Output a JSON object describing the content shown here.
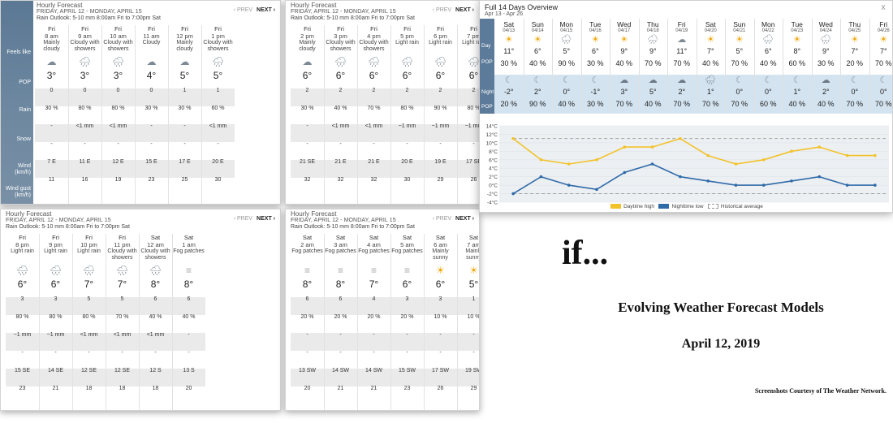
{
  "panels": [
    {
      "title": "Hourly Forecast",
      "range": "FRIDAY, APRIL 12 - MONDAY, APRIL 15",
      "outlook": "Rain Outlook: 5-10 mm 8:00am Fri to 7:00pm Sat",
      "prev": "‹ PREV",
      "next": "NEXT ›",
      "hours": [
        {
          "day": "Fri",
          "time": "8 am",
          "cond": "Mainly cloudy",
          "icon": "☁",
          "temp": "3°",
          "feels": "0",
          "pop": "30 %",
          "rain": "-",
          "snow": "-",
          "wind": "7 E",
          "gust": "11"
        },
        {
          "day": "Fri",
          "time": "9 am",
          "cond": "Cloudy with showers",
          "icon": "🌧",
          "temp": "3°",
          "feels": "0",
          "pop": "80 %",
          "rain": "<1 mm",
          "snow": "-",
          "wind": "11 E",
          "gust": "16"
        },
        {
          "day": "Fri",
          "time": "10 am",
          "cond": "Cloudy with showers",
          "icon": "🌧",
          "temp": "3°",
          "feels": "0",
          "pop": "80 %",
          "rain": "<1 mm",
          "snow": "-",
          "wind": "12 E",
          "gust": "19"
        },
        {
          "day": "Fri",
          "time": "11 am",
          "cond": "Cloudy",
          "icon": "☁",
          "temp": "4°",
          "feels": "0",
          "pop": "30 %",
          "rain": "-",
          "snow": "-",
          "wind": "15 E",
          "gust": "23"
        },
        {
          "day": "Fri",
          "time": "12 pm",
          "cond": "Mainly cloudy",
          "icon": "☁",
          "temp": "5°",
          "feels": "1",
          "pop": "30 %",
          "rain": "-",
          "snow": "-",
          "wind": "17 E",
          "gust": "25"
        },
        {
          "day": "Fri",
          "time": "1 pm",
          "cond": "Cloudy with showers",
          "icon": "🌧",
          "temp": "5°",
          "feels": "1",
          "pop": "60 %",
          "rain": "<1 mm",
          "snow": "-",
          "wind": "20 E",
          "gust": "30"
        }
      ]
    },
    {
      "title": "Hourly Forecast",
      "range": "FRIDAY, APRIL 12 - MONDAY, APRIL 15",
      "outlook": "Rain Outlook: 5-10 mm 8:00am Fri to 7:00pm Sat",
      "prev": "‹ PREV",
      "next": "NEXT ›",
      "hours": [
        {
          "day": "Fri",
          "time": "2 pm",
          "cond": "Mainly cloudy",
          "icon": "☁",
          "temp": "6°",
          "feels": "2",
          "pop": "30 %",
          "rain": "-",
          "snow": "-",
          "wind": "21 SE",
          "gust": "32"
        },
        {
          "day": "Fri",
          "time": "3 pm",
          "cond": "Cloudy with showers",
          "icon": "🌧",
          "temp": "6°",
          "feels": "2",
          "pop": "40 %",
          "rain": "<1 mm",
          "snow": "-",
          "wind": "21 E",
          "gust": "32"
        },
        {
          "day": "Fri",
          "time": "4 pm",
          "cond": "Cloudy with showers",
          "icon": "🌧",
          "temp": "6°",
          "feels": "2",
          "pop": "70 %",
          "rain": "<1 mm",
          "snow": "-",
          "wind": "21 E",
          "gust": "32"
        },
        {
          "day": "Fri",
          "time": "5 pm",
          "cond": "Light rain",
          "icon": "🌧",
          "temp": "6°",
          "feels": "2",
          "pop": "80 %",
          "rain": "~1 mm",
          "snow": "-",
          "wind": "20 E",
          "gust": "30"
        },
        {
          "day": "Fri",
          "time": "6 pm",
          "cond": "Light rain",
          "icon": "🌧",
          "temp": "6°",
          "feels": "2",
          "pop": "90 %",
          "rain": "~1 mm",
          "snow": "-",
          "wind": "19 E",
          "gust": "29"
        },
        {
          "day": "Fri",
          "time": "7 pm",
          "cond": "Light rain",
          "icon": "🌧",
          "temp": "6°",
          "feels": "2",
          "pop": "80 %",
          "rain": "~1 mm",
          "snow": "-",
          "wind": "17 SE",
          "gust": "26"
        }
      ]
    },
    {
      "title": "Hourly Forecast",
      "range": "FRIDAY, APRIL 12 - MONDAY, APRIL 15",
      "outlook": "Rain Outlook: 5-10 mm 8:00am Fri to 7:00pm Sat",
      "prev": "‹ PREV",
      "next": "NEXT ›",
      "hours": [
        {
          "day": "Fri",
          "time": "8 pm",
          "cond": "Light rain",
          "icon": "🌧",
          "temp": "6°",
          "feels": "3",
          "pop": "80 %",
          "rain": "~1 mm",
          "snow": "-",
          "wind": "15 SE",
          "gust": "23"
        },
        {
          "day": "Fri",
          "time": "9 pm",
          "cond": "Light rain",
          "icon": "🌧",
          "temp": "6°",
          "feels": "3",
          "pop": "80 %",
          "rain": "~1 mm",
          "snow": "-",
          "wind": "14 SE",
          "gust": "21"
        },
        {
          "day": "Fri",
          "time": "10 pm",
          "cond": "Light rain",
          "icon": "🌧",
          "temp": "7°",
          "feels": "5",
          "pop": "80 %",
          "rain": "<1 mm",
          "snow": "-",
          "wind": "12 SE",
          "gust": "18"
        },
        {
          "day": "Fri",
          "time": "11 pm",
          "cond": "Cloudy with showers",
          "icon": "🌧",
          "temp": "7°",
          "feels": "5",
          "pop": "70 %",
          "rain": "<1 mm",
          "snow": "-",
          "wind": "12 SE",
          "gust": "18"
        },
        {
          "day": "Sat",
          "time": "12 am",
          "cond": "Cloudy with showers",
          "icon": "🌧",
          "temp": "8°",
          "feels": "6",
          "pop": "40 %",
          "rain": "<1 mm",
          "snow": "-",
          "wind": "12 S",
          "gust": "18"
        },
        {
          "day": "Sat",
          "time": "1 am",
          "cond": "Fog patches",
          "icon": "≡",
          "temp": "8°",
          "feels": "6",
          "pop": "40 %",
          "rain": "-",
          "snow": "-",
          "wind": "13 S",
          "gust": "20"
        }
      ]
    },
    {
      "title": "Hourly Forecast",
      "range": "FRIDAY, APRIL 12 - MONDAY, APRIL 15",
      "outlook": "Rain Outlook: 5-10 mm 8:00am Fri to 7:00pm Sat",
      "prev": "‹ PREV",
      "next": "NEXT ›",
      "hours": [
        {
          "day": "Sat",
          "time": "2 am",
          "cond": "Fog patches",
          "icon": "≡",
          "temp": "8°",
          "feels": "6",
          "pop": "20 %",
          "rain": "-",
          "snow": "-",
          "wind": "13 SW",
          "gust": "20"
        },
        {
          "day": "Sat",
          "time": "3 am",
          "cond": "Fog patches",
          "icon": "≡",
          "temp": "8°",
          "feels": "6",
          "pop": "20 %",
          "rain": "-",
          "snow": "-",
          "wind": "14 SW",
          "gust": "21"
        },
        {
          "day": "Sat",
          "time": "4 am",
          "cond": "Fog patches",
          "icon": "≡",
          "temp": "7°",
          "feels": "4",
          "pop": "20 %",
          "rain": "-",
          "snow": "-",
          "wind": "14 SW",
          "gust": "21"
        },
        {
          "day": "Sat",
          "time": "5 am",
          "cond": "Fog patches",
          "icon": "≡",
          "temp": "6°",
          "feels": "3",
          "pop": "20 %",
          "rain": "-",
          "snow": "-",
          "wind": "15 SW",
          "gust": "23"
        },
        {
          "day": "Sat",
          "time": "6 am",
          "cond": "Mainly sunny",
          "icon": "☀",
          "temp": "6°",
          "feels": "3",
          "pop": "10 %",
          "rain": "-",
          "snow": "-",
          "wind": "17 SW",
          "gust": "26"
        },
        {
          "day": "Sat",
          "time": "7 am",
          "cond": "Mainly sunny",
          "icon": "☀",
          "temp": "5°",
          "feels": "1",
          "pop": "10 %",
          "rain": "-",
          "snow": "-",
          "wind": "19 SW",
          "gust": "29"
        }
      ]
    }
  ],
  "row_labels": {
    "feels": "Feels like",
    "pop": "POP",
    "rain": "Rain",
    "snow": "Snow",
    "wind": "Wind (km/h)",
    "gust": "Wind gust (km/h)"
  },
  "overview": {
    "title": "Full 14 Days Overview",
    "range": "Apr 13 - Apr 26",
    "close": "X",
    "day_label": "Day",
    "pop_label": "POP",
    "night_label": "Night",
    "days": [
      {
        "wd": "Sat",
        "date": "04/13",
        "day_icon": "☀",
        "high": "11°",
        "day_pop": "30 %",
        "night_icon": "☾",
        "low": "-2°",
        "night_pop": "20 %"
      },
      {
        "wd": "Sun",
        "date": "04/14",
        "day_icon": "☀",
        "high": "6°",
        "day_pop": "40 %",
        "night_icon": "☾",
        "low": "2°",
        "night_pop": "90 %"
      },
      {
        "wd": "Mon",
        "date": "04/15",
        "day_icon": "🌧",
        "high": "5°",
        "day_pop": "90 %",
        "night_icon": "☾",
        "low": "0°",
        "night_pop": "40 %"
      },
      {
        "wd": "Tue",
        "date": "04/16",
        "day_icon": "☀",
        "high": "6°",
        "day_pop": "30 %",
        "night_icon": "☾",
        "low": "-1°",
        "night_pop": "30 %"
      },
      {
        "wd": "Wed",
        "date": "04/17",
        "day_icon": "☀",
        "high": "9°",
        "day_pop": "40 %",
        "night_icon": "☁",
        "low": "3°",
        "night_pop": "70 %"
      },
      {
        "wd": "Thu",
        "date": "04/18",
        "day_icon": "🌧",
        "high": "9°",
        "day_pop": "70 %",
        "night_icon": "☁",
        "low": "5°",
        "night_pop": "40 %"
      },
      {
        "wd": "Fri",
        "date": "04/19",
        "day_icon": "☁",
        "high": "11°",
        "day_pop": "70 %",
        "night_icon": "☁",
        "low": "2°",
        "night_pop": "70 %"
      },
      {
        "wd": "Sat",
        "date": "04/20",
        "day_icon": "☀",
        "high": "7°",
        "day_pop": "40 %",
        "night_icon": "🌧",
        "low": "1°",
        "night_pop": "70 %"
      },
      {
        "wd": "Sun",
        "date": "04/21",
        "day_icon": "☀",
        "high": "5°",
        "day_pop": "70 %",
        "night_icon": "☾",
        "low": "0°",
        "night_pop": "70 %"
      },
      {
        "wd": "Mon",
        "date": "04/22",
        "day_icon": "🌧",
        "high": "6°",
        "day_pop": "40 %",
        "night_icon": "☾",
        "low": "0°",
        "night_pop": "60 %"
      },
      {
        "wd": "Tue",
        "date": "04/23",
        "day_icon": "☀",
        "high": "8°",
        "day_pop": "60 %",
        "night_icon": "☾",
        "low": "1°",
        "night_pop": "40 %"
      },
      {
        "wd": "Wed",
        "date": "04/24",
        "day_icon": "🌧",
        "high": "9°",
        "day_pop": "30 %",
        "night_icon": "☁",
        "low": "2°",
        "night_pop": "40 %"
      },
      {
        "wd": "Thu",
        "date": "04/25",
        "day_icon": "☀",
        "high": "7°",
        "day_pop": "20 %",
        "night_icon": "☾",
        "low": "0°",
        "night_pop": "70 %"
      },
      {
        "wd": "Fri",
        "date": "04/26",
        "day_icon": "☀",
        "high": "7°",
        "day_pop": "70 %",
        "night_icon": "☾",
        "low": "0°",
        "night_pop": "70 %"
      }
    ]
  },
  "chart_data": {
    "type": "line",
    "x": [
      "04/13",
      "04/14",
      "04/15",
      "04/16",
      "04/17",
      "04/18",
      "04/19",
      "04/20",
      "04/21",
      "04/22",
      "04/23",
      "04/24",
      "04/25",
      "04/26"
    ],
    "series": [
      {
        "name": "Daytime high",
        "values": [
          11,
          6,
          5,
          6,
          9,
          9,
          11,
          7,
          5,
          6,
          8,
          9,
          7,
          7
        ],
        "color": "#f2c22a"
      },
      {
        "name": "Nighttime low",
        "values": [
          -2,
          2,
          0,
          -1,
          3,
          5,
          2,
          1,
          0,
          0,
          1,
          2,
          0,
          0
        ],
        "color": "#2f6aa8"
      }
    ],
    "historical_average": {
      "name": "Historical average",
      "high": 11,
      "low": -2
    },
    "yticks": [
      "-4°C",
      "-2°C",
      "0°C",
      "2°C",
      "4°C",
      "6°C",
      "8°C",
      "10°C",
      "12°C",
      "14°C"
    ],
    "ylim": [
      -4,
      14
    ],
    "grid": true,
    "legend": "bottom"
  },
  "slide": {
    "if_text": "if...",
    "title": "Evolving Weather Forecast Models",
    "date": "April 12, 2019",
    "credit": "Screenshots Courtesy of The Weather Network."
  },
  "colors": {
    "sidebar": "#5c7a99",
    "night_row": "#d3e3ef",
    "high_line": "#f2c22a",
    "low_line": "#2f6aa8"
  }
}
